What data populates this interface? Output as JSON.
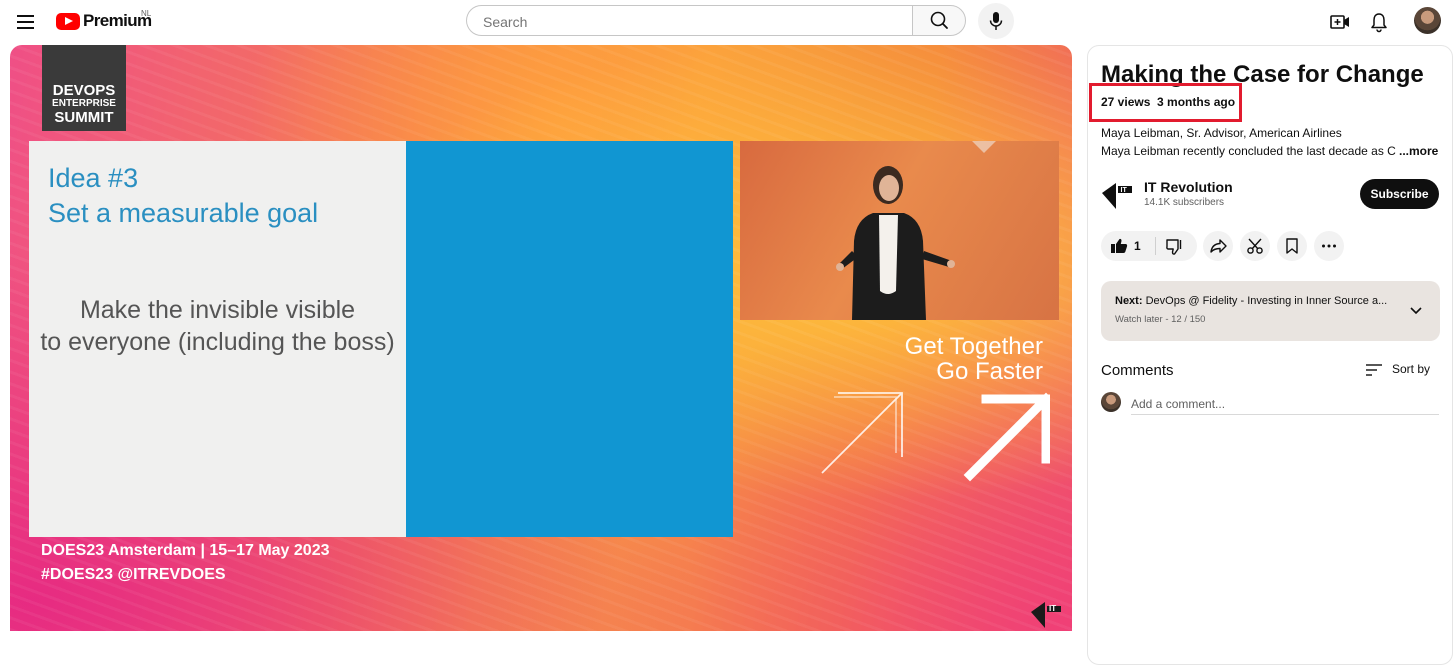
{
  "header": {
    "logo_text": "Premium",
    "country_code": "NL",
    "search_placeholder": "Search"
  },
  "video": {
    "event_badge": [
      "DEVOPS",
      "ENTERPRISE",
      "SUMMIT"
    ],
    "slide_title_1": "Idea #3",
    "slide_title_2": "Set a measurable goal",
    "slide_body_1": "Make the invisible visible",
    "slide_body_2": "to everyone (including the boss)",
    "tagline_1": "Get Together",
    "tagline_2": "Go Faster",
    "footer_1": "DOES23 Amsterdam  |  15–17 May 2023",
    "footer_2": "#DOES23  @ITREVDOES",
    "watermark": "IT"
  },
  "panel": {
    "title": "Making the Case for Change",
    "views": "27 views",
    "age": "3 months ago",
    "description_line_1": "Maya Leibman, Sr. Advisor, American Airlines",
    "description_line_2": "Maya Leibman recently concluded the last decade as Chi",
    "more_label": "...more",
    "channel_name": "IT Revolution",
    "channel_subscribers": "14.1K subscribers",
    "subscribe_label": "Subscribe",
    "like_count": "1",
    "next_label": "Next:",
    "next_title": "DevOps @ Fidelity - Investing in Inner Source a...",
    "next_meta": "Watch later - 12 / 150",
    "comments_label": "Comments",
    "sort_label": "Sort by",
    "comment_placeholder": "Add a comment..."
  },
  "colors": {
    "brand_red": "#ff0000",
    "highlight_border": "#e21b2e",
    "slide_blue": "#1196d2",
    "slide_title_blue": "#2a8fc1",
    "subscribe_bg": "#0f0f0f"
  },
  "icons": [
    "menu-icon",
    "youtube-logo-icon",
    "search-icon",
    "microphone-icon",
    "create-video-icon",
    "bell-icon",
    "like-icon",
    "dislike-icon",
    "share-icon",
    "clip-icon",
    "save-icon",
    "more-icon",
    "chevron-down-icon",
    "sort-icon"
  ]
}
